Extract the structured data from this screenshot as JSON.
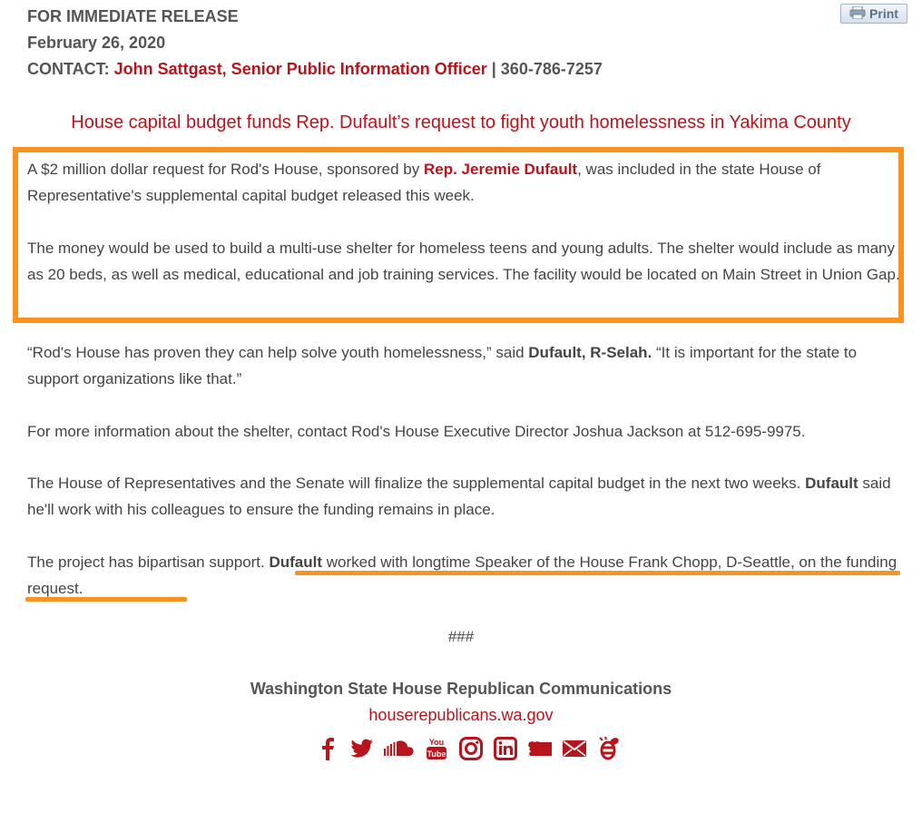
{
  "header": {
    "release": "FOR IMMEDIATE RELEASE",
    "date": "February 26, 2020",
    "contact_label": "CONTACT:",
    "contact_name": "John Sattgast, Senior Public Information Officer",
    "separator": "|",
    "contact_phone": "360-786-7257"
  },
  "print_label": "Print",
  "headline": "House capital budget funds Rep. Dufault’s request to fight youth homelessness in Yakima County",
  "p1": {
    "before": "A $2 million dollar request for Rod's House, sponsored by ",
    "link": "Rep. Jeremie Dufault",
    "after": ", was included in the state House of Representative's supplemental capital budget released this week."
  },
  "p2": "The money would be used to build a multi-use shelter for homeless teens and young adults. The shelter would in­clude as many as 20 beds, as well as medical, educational and job training services. The facility would be located on Main Street in Union Gap.",
  "p3": {
    "quote1": "“Rod's House has proven they can help solve youth homelessness,” said ",
    "speaker": "Dufault, R-Selah.",
    "quote2": " “It is important for the state to support organizations like that.”"
  },
  "p4": "For more information about the shelter, contact Rod's House Executive Director Joshua Jackson at 512-695-9975.",
  "p5": {
    "line1": "The House of Representatives and the Senate will finalize the supplemental capital budget in the next two weeks. ",
    "name": "Dufault",
    "line2": " said he'll work with his colleagues to ensure the funding remains in place."
  },
  "p6": {
    "before": "The project has bipartisan support. ",
    "name": "Dufault",
    "after": " worked with longtime Speaker of the House Frank Chopp, D-Seattle, on the funding request."
  },
  "hash": "###",
  "footer": {
    "org": "Washington State House Republican Communications",
    "url": "houserepublicans.wa.gov",
    "youtube_text_top": "You",
    "youtube_text_bottom": "Tube"
  },
  "colors": {
    "accent_red": "#b8141b",
    "highlight_orange": "#f7931e"
  },
  "icons": [
    "facebook-icon",
    "twitter-icon",
    "soundcloud-icon",
    "youtube-icon",
    "instagram-icon",
    "linkedin-icon",
    "washington-state-icon",
    "email-icon",
    "bee-icon"
  ]
}
